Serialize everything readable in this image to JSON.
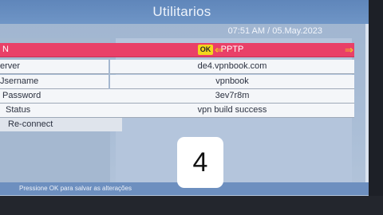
{
  "window": {
    "title": "Utilitarios",
    "datetime": "07:51 AM / 05.May.2023"
  },
  "vpn_row": {
    "label": "N",
    "ok": "OK",
    "value": "PPTP",
    "left_arrow": "⇐",
    "right_arrow": "⇒"
  },
  "fields": [
    {
      "label": "erver",
      "value": "de4.vpnbook.com"
    },
    {
      "label": "Jsername",
      "value": "vpnbook"
    },
    {
      "label": "Password",
      "value": "3ev7r8m"
    },
    {
      "label": "Status",
      "value": "vpn build success"
    }
  ],
  "reconnect_label": "Re-connect",
  "status_bar": "Pressione OK para salvar as alterações",
  "overlay_badge": "4",
  "colors": {
    "title_bar": "#6a8fc1",
    "highlight": "#e94068",
    "ok_badge": "#f4d61c",
    "panel": "#b4c5dc"
  }
}
